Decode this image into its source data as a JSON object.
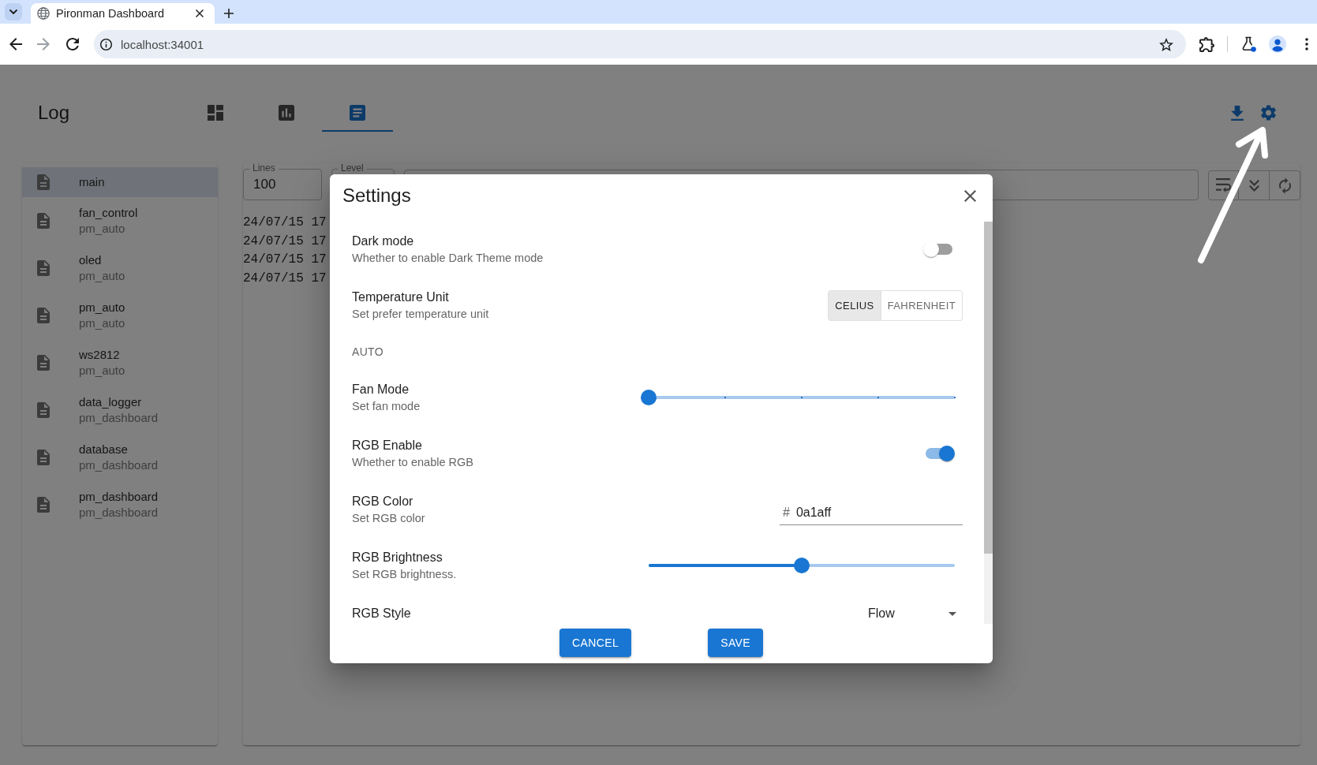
{
  "browser": {
    "tab_title": "Pironman Dashboard",
    "address": "localhost:34001"
  },
  "page": {
    "title": "Log",
    "tabs": [
      {
        "kind": "dashboard",
        "selected": false
      },
      {
        "kind": "chart",
        "selected": false
      },
      {
        "kind": "log",
        "selected": true
      }
    ]
  },
  "sidebar": {
    "items": [
      {
        "title": "main",
        "selected": true
      },
      {
        "title": "fan_control",
        "subtitle": "pm_auto",
        "selected": false
      },
      {
        "title": "oled",
        "subtitle": "pm_auto",
        "selected": false
      },
      {
        "title": "pm_auto",
        "subtitle": "pm_auto",
        "selected": false
      },
      {
        "title": "ws2812",
        "subtitle": "pm_auto",
        "selected": false
      },
      {
        "title": "data_logger",
        "subtitle": "pm_dashboard",
        "selected": false
      },
      {
        "title": "database",
        "subtitle": "pm_dashboard",
        "selected": false
      },
      {
        "title": "pm_dashboard",
        "subtitle": "pm_dashboard",
        "selected": false
      }
    ]
  },
  "log": {
    "lines_field": {
      "label": "Lines",
      "value": "100"
    },
    "level_field": {
      "label": "Level"
    },
    "lines": [
      "24/07/15 17",
      "24/07/15 17",
      "24/07/15 17",
      "24/07/15 17"
    ]
  },
  "dialog": {
    "title": "Settings",
    "settings": [
      {
        "kind": "switch",
        "title": "Dark mode",
        "description": "Whether to enable Dark Theme mode",
        "on": false
      },
      {
        "kind": "toggle_group",
        "title": "Temperature Unit",
        "description": "Set prefer temperature unit",
        "options": [
          {
            "label": "CELIUS",
            "selected": true
          },
          {
            "label": "FAHRENHEIT",
            "selected": false
          }
        ]
      },
      {
        "kind": "section",
        "title": "AUTO"
      },
      {
        "kind": "stepped_slider",
        "title": "Fan Mode",
        "description": "Set fan mode",
        "level": 0
      },
      {
        "kind": "switch",
        "title": "RGB Enable",
        "description": "Whether to enable RGB",
        "on": true
      },
      {
        "kind": "text_field",
        "title": "RGB Color",
        "description": "Set RGB color",
        "prefix": "#",
        "value": "0a1aff"
      },
      {
        "kind": "slider",
        "title": "RGB Brightness",
        "description": "Set RGB brightness.",
        "level": 0.5
      },
      {
        "kind": "select",
        "title": "RGB Style",
        "value": "Flow"
      }
    ],
    "buttons": [
      "CANCEL",
      "SAVE"
    ]
  }
}
